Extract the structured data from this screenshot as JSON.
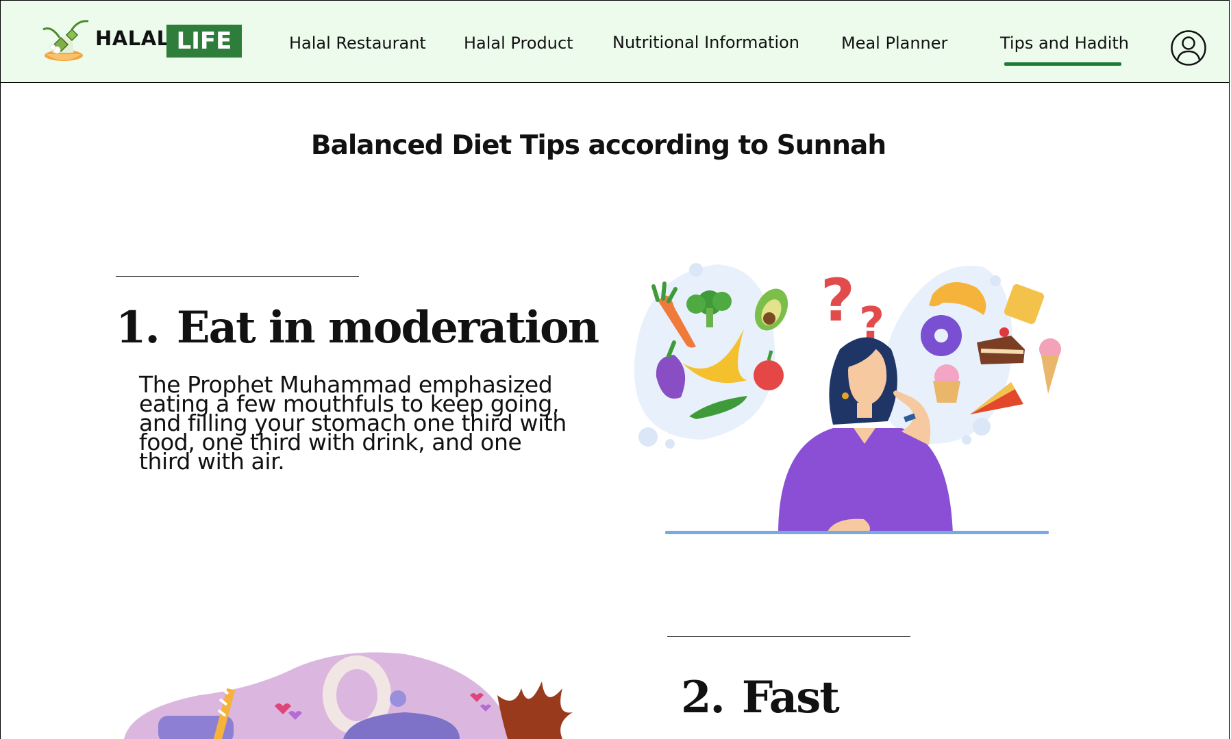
{
  "brand": {
    "word1": "HALAL",
    "word2": "LIFE"
  },
  "nav": {
    "items": [
      {
        "label": "Halal Restaurant"
      },
      {
        "label": "Halal Product"
      },
      {
        "label": "Nutritional Information"
      },
      {
        "label": "Meal Planner"
      },
      {
        "label": "Tips and Hadith",
        "active": true
      }
    ],
    "profile_icon": "user-circle-icon",
    "active_color": "#1f7a33",
    "background": "#ecfbec"
  },
  "page": {
    "title": "Balanced Diet Tips according to Sunnah"
  },
  "tips": [
    {
      "number": "1.",
      "title": "Eat in moderation",
      "body": "The Prophet Muhammad emphasized eating a few mouthfuls to keep going, and filling your stomach one third with food, one third with drink, and one third with air.",
      "image_icon": "woman-thinking-about-food-illustration"
    },
    {
      "number": "2.",
      "title": "Fast",
      "image_icon": "teapot-and-drinks-illustration"
    }
  ]
}
